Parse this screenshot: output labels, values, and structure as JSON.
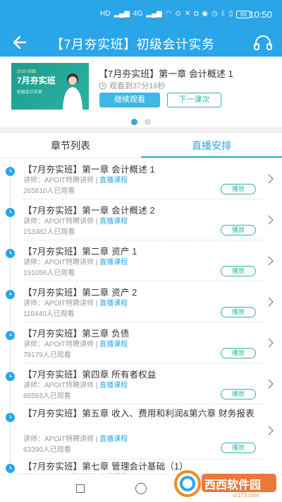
{
  "status_bar": {
    "network": "HD",
    "signal_1": "4G",
    "battery": "93",
    "time": "10:50"
  },
  "header": {
    "title": "【7月夯实班】初级会计实务"
  },
  "now_playing": {
    "thumb": {
      "tag": "2020 初级",
      "title": "7月夯实班",
      "subtitle": "初级会计实务"
    },
    "title": "【7月夯实班】第一章 会计概述 1",
    "progress": "观看到37分16秒",
    "continue_label": "继续观看",
    "next_label": "下一课次",
    "pages": 2,
    "active_page": 1
  },
  "tabs": {
    "chapters": "章节列表",
    "live": "直播安排",
    "active": "live"
  },
  "lesson_common": {
    "teacher": "讲师：APOIT特聘讲师",
    "sep": " | ",
    "course_link": "直播课程",
    "play_label": "播放"
  },
  "lessons": [
    {
      "title": "【7月夯实班】第一章 会计概述 1",
      "views": "265810人已观看"
    },
    {
      "title": "【7月夯实班】第一章 会计概述 2",
      "views": "153382人已观看"
    },
    {
      "title": "【7月夯实班】第二章 资产 1",
      "views": "191056人已观看"
    },
    {
      "title": "【7月夯实班】第二章 资产 2",
      "views": "110440人已观看"
    },
    {
      "title": "【7月夯实班】第三章 负债",
      "views": "79179人已观看"
    },
    {
      "title": "【7月夯实班】第四章 所有者权益",
      "views": "66593人已观看"
    },
    {
      "title": "【7月夯实班】第五章 收入、费用和利润&第六章 财务报表",
      "views": "63390人已观看"
    },
    {
      "title": "【7月夯实班】第七章 管理会计基础（1）",
      "views": ""
    }
  ],
  "watermark": {
    "brand": "西西软件园",
    "site": "cr173.com"
  },
  "colors": {
    "primary": "#2aa5e8",
    "teal": "#2fb5a3",
    "muted": "#999999"
  }
}
